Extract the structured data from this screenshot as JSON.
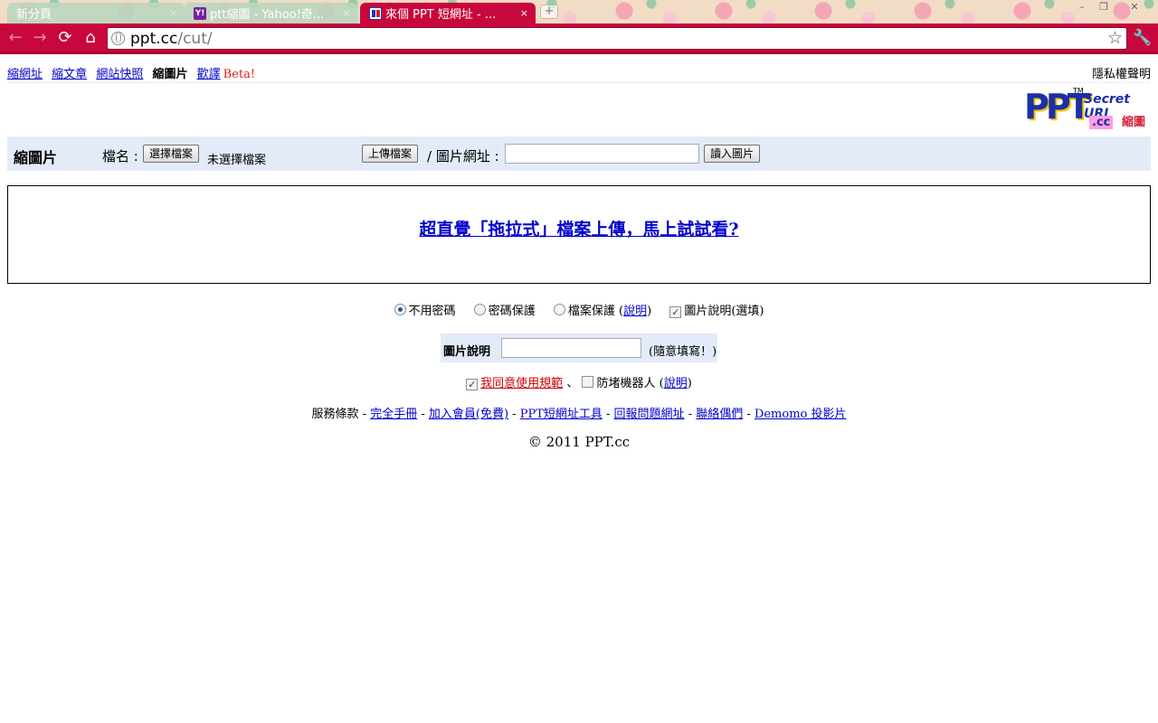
{
  "browser": {
    "tabs": [
      {
        "title": "新分頁",
        "close": "×",
        "active": false
      },
      {
        "title": "ptt縮圖 - Yahoo!奇...",
        "close": "×",
        "active": false,
        "favicon_text": "Y!"
      },
      {
        "title": "來個 PPT 短網址 - ...",
        "close": "×",
        "active": true
      }
    ],
    "newtab": "+",
    "window_controls": {
      "minimize": "–",
      "maximize": "❐",
      "close": "✕"
    },
    "nav": {
      "back": "←",
      "forward": "→",
      "reload": "⟳",
      "home": "⌂"
    },
    "url_host": "ppt.cc",
    "url_path": "/cut/",
    "bookmark_star": "☆",
    "wrench": "🔧",
    "colors": {
      "toolbar": "#c8073d",
      "active_tab": "#c8073d"
    }
  },
  "topnav": {
    "items": [
      "縮網址",
      "縮文章",
      "網站快照",
      "縮圖片",
      "歡譯"
    ],
    "current": "縮圖片",
    "beta": "Beta!",
    "privacy": "隱私權聲明"
  },
  "logo": {
    "ppt": "PPT",
    "tm": "TM",
    "secret": "Secret URL",
    "cc": ".cc",
    "cut": "縮圖"
  },
  "upload": {
    "title": "縮圖片",
    "file_label": "檔名 :",
    "choose_file": "選擇檔案",
    "no_file": "未選擇檔案",
    "upload_button": "上傳檔案",
    "url_label": "/ 圖片網址 :",
    "url_value": "",
    "load_button": "讀入圖片"
  },
  "dropzone": {
    "text": "超直覺「拖拉式」檔案上傳，馬上試試看?"
  },
  "options": {
    "no_password": "不用密碼",
    "password_protect": "密碼保護",
    "file_protect": "檔案保護",
    "explain_open": "(",
    "explain": "說明",
    "explain_close": ")",
    "image_desc": "圖片說明(選填)"
  },
  "description": {
    "label": "圖片說明",
    "value": "",
    "hint": "(隨意填寫！)"
  },
  "agree": {
    "terms": "我同意使用規範",
    "sep": "、",
    "anti_robot": "防堵機器人",
    "explain": "說明"
  },
  "footer": {
    "prefix": "服務條款 -",
    "links": [
      "完全手冊",
      "加入會員(免費)",
      "PPT短網址工具",
      "回報問題網址",
      "聯絡偶們",
      "Demomo 投影片"
    ],
    "copyright": "© 2011 PPT.cc"
  }
}
